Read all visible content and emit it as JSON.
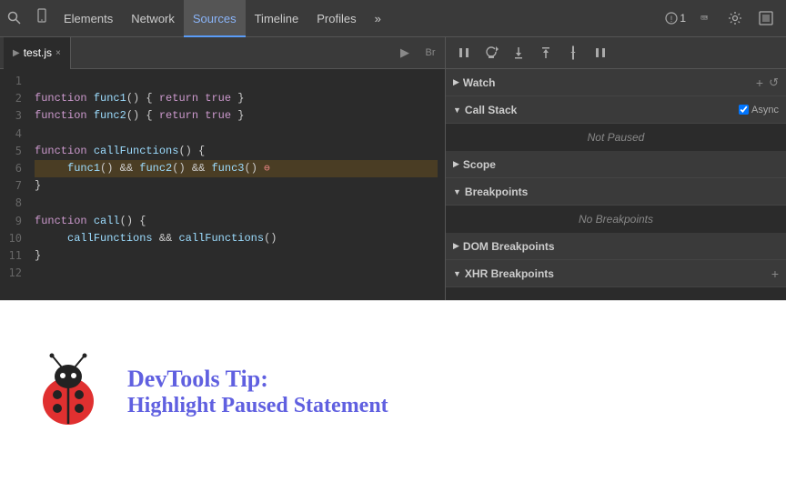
{
  "toolbar": {
    "tabs": [
      "Elements",
      "Network",
      "Sources",
      "Timeline",
      "Profiles"
    ],
    "active_tab": "Sources",
    "more_icon": "»",
    "badge_count": "1",
    "icons": {
      "console": ">_",
      "settings": "⚙",
      "monitor": "⬜"
    }
  },
  "editor": {
    "tab_label": "test.js",
    "code_lines": [
      "",
      "function func1() { return true }",
      "function func2() { return true }",
      "",
      "function callFunctions() {",
      "     func1() && func2() && func3()",
      "}",
      "",
      "function call() {",
      "     callFunctions && callFunctions()",
      "}"
    ],
    "line_numbers": [
      "1",
      "2",
      "3",
      "4",
      "5",
      "6",
      "7",
      "8",
      "9",
      "10",
      "11",
      "12"
    ]
  },
  "debug_toolbar": {
    "pause_label": "⏸",
    "step_over_label": "↺",
    "step_into_label": "↓",
    "step_out_label": "↑",
    "deactivate_label": "/",
    "pause2_label": "⏸"
  },
  "debugger": {
    "sections": [
      {
        "title": "Watch",
        "expanded": true,
        "arrow": "▶",
        "actions": [
          "+",
          "↺"
        ],
        "content": null
      },
      {
        "title": "Call Stack",
        "expanded": true,
        "arrow": "▼",
        "actions": [],
        "async_label": "Async",
        "content": "Not Paused"
      },
      {
        "title": "Scope",
        "expanded": false,
        "arrow": "▶",
        "actions": [],
        "content": null
      },
      {
        "title": "Breakpoints",
        "expanded": true,
        "arrow": "▼",
        "actions": [],
        "content": "No Breakpoints"
      },
      {
        "title": "DOM Breakpoints",
        "expanded": false,
        "arrow": "▶",
        "actions": [],
        "content": null
      },
      {
        "title": "XHR Breakpoints",
        "expanded": false,
        "arrow": "▼",
        "actions": [],
        "content": null
      }
    ]
  },
  "tip": {
    "title": "DevTools Tip:",
    "subtitle": "Highlight Paused Statement",
    "ladybug_alt": "ladybug mascot"
  }
}
